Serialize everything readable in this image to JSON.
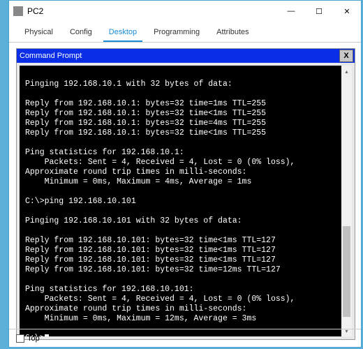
{
  "window": {
    "title": "PC2",
    "controls": {
      "min": "—",
      "max": "☐",
      "close": "✕"
    }
  },
  "tabs": [
    {
      "id": "physical",
      "label": "Physical"
    },
    {
      "id": "config",
      "label": "Config"
    },
    {
      "id": "desktop",
      "label": "Desktop"
    },
    {
      "id": "programming",
      "label": "Programming"
    },
    {
      "id": "attributes",
      "label": "Attributes"
    }
  ],
  "active_tab": "desktop",
  "cmd": {
    "title": "Command Prompt",
    "close_label": "X",
    "lines": [
      "",
      "Pinging 192.168.10.1 with 32 bytes of data:",
      "",
      "Reply from 192.168.10.1: bytes=32 time=1ms TTL=255",
      "Reply from 192.168.10.1: bytes=32 time<1ms TTL=255",
      "Reply from 192.168.10.1: bytes=32 time=4ms TTL=255",
      "Reply from 192.168.10.1: bytes=32 time<1ms TTL=255",
      "",
      "Ping statistics for 192.168.10.1:",
      "    Packets: Sent = 4, Received = 4, Lost = 0 (0% loss),",
      "Approximate round trip times in milli-seconds:",
      "    Minimum = 0ms, Maximum = 4ms, Average = 1ms",
      "",
      "C:\\>ping 192.168.10.101",
      "",
      "Pinging 192.168.10.101 with 32 bytes of data:",
      "",
      "Reply from 192.168.10.101: bytes=32 time<1ms TTL=127",
      "Reply from 192.168.10.101: bytes=32 time<1ms TTL=127",
      "Reply from 192.168.10.101: bytes=32 time<1ms TTL=127",
      "Reply from 192.168.10.101: bytes=32 time=12ms TTL=127",
      "",
      "Ping statistics for 192.168.10.101:",
      "    Packets: Sent = 4, Received = 4, Lost = 0 (0% loss),",
      "Approximate round trip times in milli-seconds:",
      "    Minimum = 0ms, Maximum = 12ms, Average = 3ms",
      "",
      "C:\\>"
    ]
  },
  "bottom": {
    "top_label": "Top"
  }
}
